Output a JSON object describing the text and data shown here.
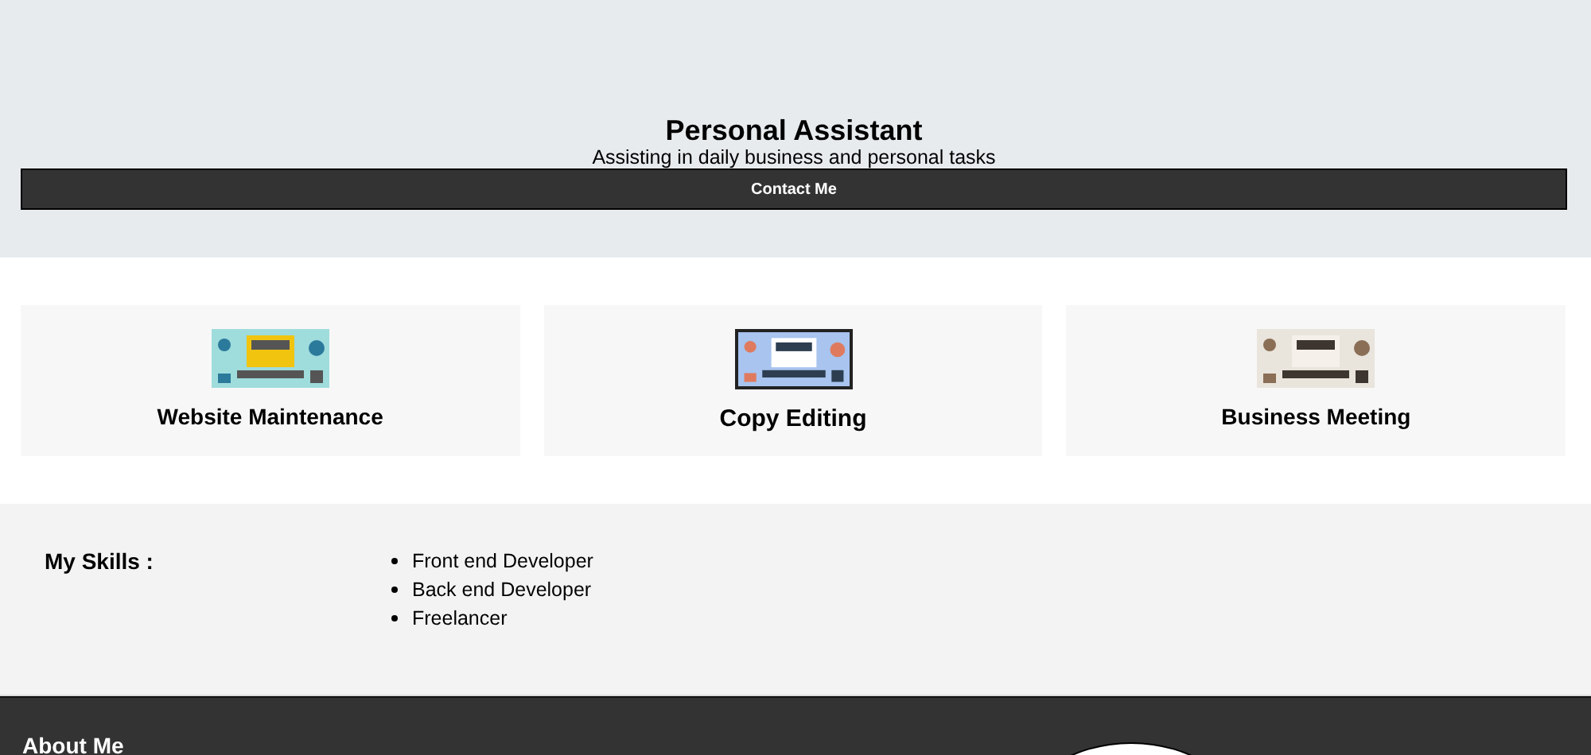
{
  "header": {
    "title": "Personal Assistant",
    "subtitle": "Assisting in daily business and personal tasks",
    "button": "Contact Me"
  },
  "services": [
    {
      "title": "Website Maintenance"
    },
    {
      "title": "Copy Editing"
    },
    {
      "title": "Business Meeting"
    }
  ],
  "skills": {
    "heading": "My Skills :",
    "items": [
      "Front end Developer",
      "Back end Developer",
      "Freelancer"
    ]
  },
  "about": {
    "heading": "About Me"
  }
}
